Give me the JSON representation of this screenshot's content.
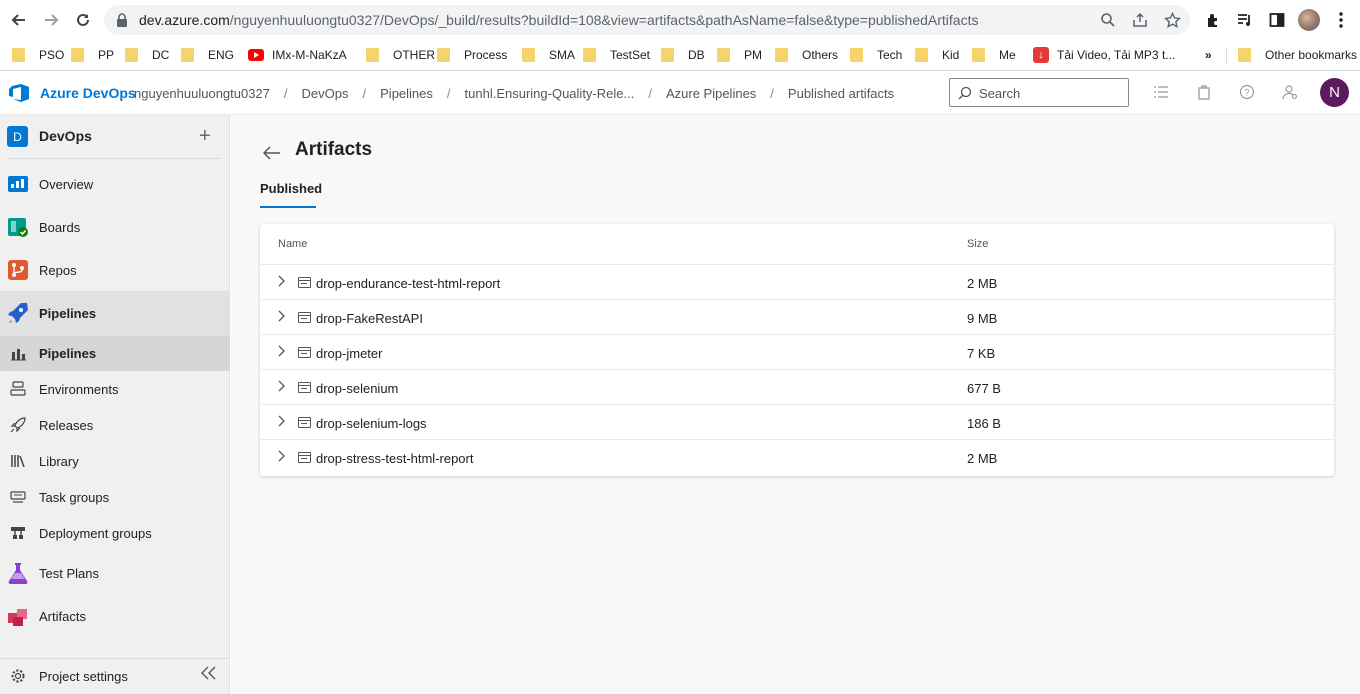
{
  "browser": {
    "url_host": "dev.azure.com",
    "url_path": "/nguyenhuuluongtu0327/DevOps/_build/results?buildId=108&view=artifacts&pathAsName=false&type=publishedArtifacts",
    "bookmarks": [
      {
        "label": "PSO",
        "icon": "folder-icon"
      },
      {
        "label": "PP",
        "icon": "folder-icon"
      },
      {
        "label": "DC",
        "icon": "folder-icon"
      },
      {
        "label": "ENG",
        "icon": "folder-icon"
      },
      {
        "label": "IMx-M-NaKzA",
        "icon": "youtube-icon"
      },
      {
        "label": "OTHER",
        "icon": "folder-icon"
      },
      {
        "label": "Process",
        "icon": "folder-icon"
      },
      {
        "label": "SMA",
        "icon": "folder-icon"
      },
      {
        "label": "TestSet",
        "icon": "folder-icon"
      },
      {
        "label": "DB",
        "icon": "folder-icon"
      },
      {
        "label": "PM",
        "icon": "folder-icon"
      },
      {
        "label": "Others",
        "icon": "folder-icon"
      },
      {
        "label": "Tech",
        "icon": "folder-icon"
      },
      {
        "label": "Kid",
        "icon": "folder-icon"
      },
      {
        "label": "Me",
        "icon": "folder-icon"
      },
      {
        "label": "Tải Video, Tải MP3 t...",
        "icon": "download-icon"
      }
    ],
    "more_bookmarks": "»",
    "other_bookmarks": "Other bookmarks"
  },
  "header": {
    "brand": "Azure DevOps",
    "breadcrumbs": [
      "nguyenhuuluongtu0327",
      "DevOps",
      "Pipelines",
      "tunhl.Ensuring-Quality-Rele...",
      "Azure Pipelines",
      "Published artifacts"
    ],
    "search_placeholder": "Search",
    "user_initial": "N"
  },
  "sidebar": {
    "project_initial": "D",
    "project_name": "DevOps",
    "items": [
      {
        "label": "Overview",
        "icon": "overview-icon"
      },
      {
        "label": "Boards",
        "icon": "boards-icon"
      },
      {
        "label": "Repos",
        "icon": "repos-icon"
      },
      {
        "label": "Pipelines",
        "icon": "pipelines-icon"
      },
      {
        "label": "Pipelines",
        "icon": "pipelines-sub-icon"
      },
      {
        "label": "Environments",
        "icon": "environments-icon"
      },
      {
        "label": "Releases",
        "icon": "releases-icon"
      },
      {
        "label": "Library",
        "icon": "library-icon"
      },
      {
        "label": "Task groups",
        "icon": "task-groups-icon"
      },
      {
        "label": "Deployment groups",
        "icon": "deployment-groups-icon"
      },
      {
        "label": "Test Plans",
        "icon": "test-plans-icon"
      },
      {
        "label": "Artifacts",
        "icon": "artifacts-icon"
      }
    ],
    "settings": "Project settings"
  },
  "main": {
    "title": "Artifacts",
    "tab": "Published",
    "columns": {
      "name": "Name",
      "size": "Size"
    },
    "rows": [
      {
        "name": "drop-endurance-test-html-report",
        "size": "2 MB"
      },
      {
        "name": "drop-FakeRestAPI",
        "size": "9 MB"
      },
      {
        "name": "drop-jmeter",
        "size": "7 KB"
      },
      {
        "name": "drop-selenium",
        "size": "677 B"
      },
      {
        "name": "drop-selenium-logs",
        "size": "186 B"
      },
      {
        "name": "drop-stress-test-html-report",
        "size": "2 MB"
      }
    ]
  },
  "colors": {
    "accent": "#0078d4",
    "user_avatar": "#5c1a5f"
  }
}
